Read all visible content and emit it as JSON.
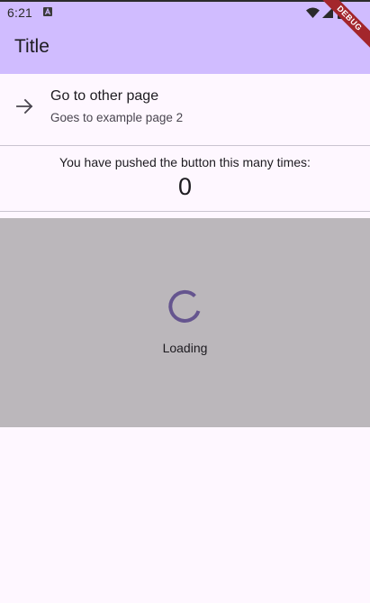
{
  "status_bar": {
    "time": "6:21",
    "icons": [
      "notification-icon",
      "wifi-icon",
      "signal-icon",
      "battery-icon"
    ]
  },
  "app_bar": {
    "title": "Title",
    "background": "#d0bcff"
  },
  "debug_banner": {
    "label": "DEBUG",
    "color": "#a3262c"
  },
  "list_tile": {
    "icon": "arrow-forward-icon",
    "title": "Go to other page",
    "subtitle": "Goes to example page 2"
  },
  "counter": {
    "label": "You have pushed the button this many times:",
    "value": "0"
  },
  "loading": {
    "text": "Loading",
    "spinner_color": "#65558f",
    "overlay_color": "#bbb7bb"
  },
  "colors": {
    "background": "#fef7ff",
    "divider": "#cac4d0",
    "text": "#1d1b20"
  }
}
